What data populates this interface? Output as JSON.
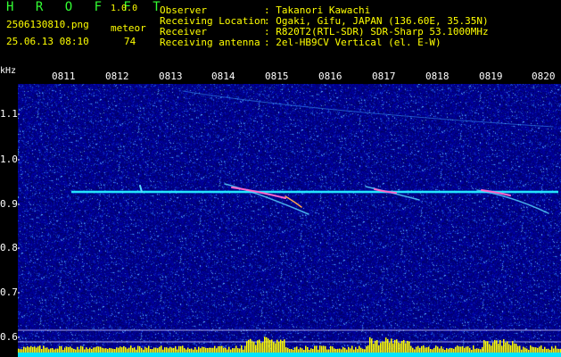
{
  "header": {
    "app_title": "HROFFT",
    "version": "1.0.0",
    "filename": "2506130810.png",
    "datetime": "25.06.13 08:10",
    "meteor_label": "meteor",
    "meteor_count": "74",
    "fields": [
      {
        "label": "Observer",
        "value": ": Takanori Kawachi"
      },
      {
        "label": "Receiving Location",
        "value": ": Ogaki, Gifu, JAPAN (136.60E, 35.35N)"
      },
      {
        "label": "Receiver",
        "value": ": R820T2(RTL-SDR) SDR-Sharp 53.1000MHz"
      },
      {
        "label": "Receiving antenna",
        "value": ": 2el-HB9CV Vertical (el. E-W)"
      }
    ]
  },
  "axis": {
    "y_unit": "kHz",
    "y_ticks": [
      "1.1",
      "1.0",
      "0.9",
      "0.8",
      "0.7",
      "0.6"
    ],
    "x_ticks": [
      "0811",
      "0812",
      "0813",
      "0814",
      "0815",
      "0816",
      "0817",
      "0818",
      "0819",
      "0820"
    ]
  },
  "colors": {
    "background": "#000000",
    "plot_base": "#00008c",
    "signal": "#00ffff",
    "meteor_hot": "#ff60c0",
    "title_green": "#33ff33",
    "label_yellow": "#ffff00",
    "level_bar": "#ffff00"
  }
}
